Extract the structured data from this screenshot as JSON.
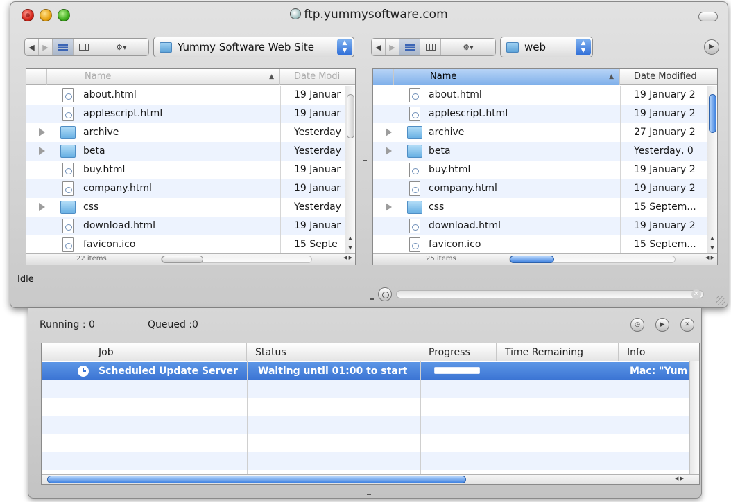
{
  "window": {
    "title": "ftp.yummysoftware.com"
  },
  "left_panel": {
    "location": "Yummy Software Web Site",
    "columns": {
      "name": "Name",
      "date": "Date Modi"
    },
    "items": [
      {
        "name": "about.html",
        "date": "19 Januar",
        "kind": "file"
      },
      {
        "name": "applescript.html",
        "date": "19 Januar",
        "kind": "file"
      },
      {
        "name": "archive",
        "date": "Yesterday",
        "kind": "folder"
      },
      {
        "name": "beta",
        "date": "Yesterday",
        "kind": "folder"
      },
      {
        "name": "buy.html",
        "date": "19 Januar",
        "kind": "file"
      },
      {
        "name": "company.html",
        "date": "19 Januar",
        "kind": "file"
      },
      {
        "name": "css",
        "date": "Yesterday",
        "kind": "folder"
      },
      {
        "name": "download.html",
        "date": "19 Januar",
        "kind": "file"
      },
      {
        "name": "favicon.ico",
        "date": "15 Septe",
        "kind": "file"
      }
    ],
    "item_count": "22 items"
  },
  "right_panel": {
    "location": "web",
    "columns": {
      "name": "Name",
      "date": "Date Modified"
    },
    "items": [
      {
        "name": "about.html",
        "date": "19 January 2",
        "kind": "file"
      },
      {
        "name": "applescript.html",
        "date": "19 January 2",
        "kind": "file"
      },
      {
        "name": "archive",
        "date": "27 January 2",
        "kind": "folder"
      },
      {
        "name": "beta",
        "date": "Yesterday, 0",
        "kind": "folder"
      },
      {
        "name": "buy.html",
        "date": "19 January 2",
        "kind": "file"
      },
      {
        "name": "company.html",
        "date": "19 January 2",
        "kind": "file"
      },
      {
        "name": "css",
        "date": "15 Septem...",
        "kind": "folder"
      },
      {
        "name": "download.html",
        "date": "19 January 2",
        "kind": "file"
      },
      {
        "name": "favicon.ico",
        "date": "15 Septem...",
        "kind": "file"
      }
    ],
    "item_count": "25 items"
  },
  "status": {
    "text": "Idle"
  },
  "queue": {
    "running_label": "Running : 0",
    "queued_label": "Queued :0",
    "columns": [
      "Job",
      "Status",
      "Progress",
      "Time Remaining",
      "Info"
    ],
    "rows": [
      {
        "job": "Scheduled Update Server",
        "status": "Waiting until 01:00 to start",
        "progress": 0,
        "time_remaining": "",
        "info": "Mac: \"Yum"
      }
    ]
  },
  "colors": {
    "selection": "#3b74d3",
    "stripe": "#edf3fe",
    "chrome": "#d7d7d7"
  },
  "icons": [
    "close-button",
    "minimize-button",
    "zoom-button",
    "globe-icon",
    "back-icon",
    "forward-icon",
    "list-view-icon",
    "column-view-icon",
    "gear-icon",
    "folder-icon",
    "file-icon",
    "clock-icon",
    "play-icon",
    "stop-icon"
  ]
}
